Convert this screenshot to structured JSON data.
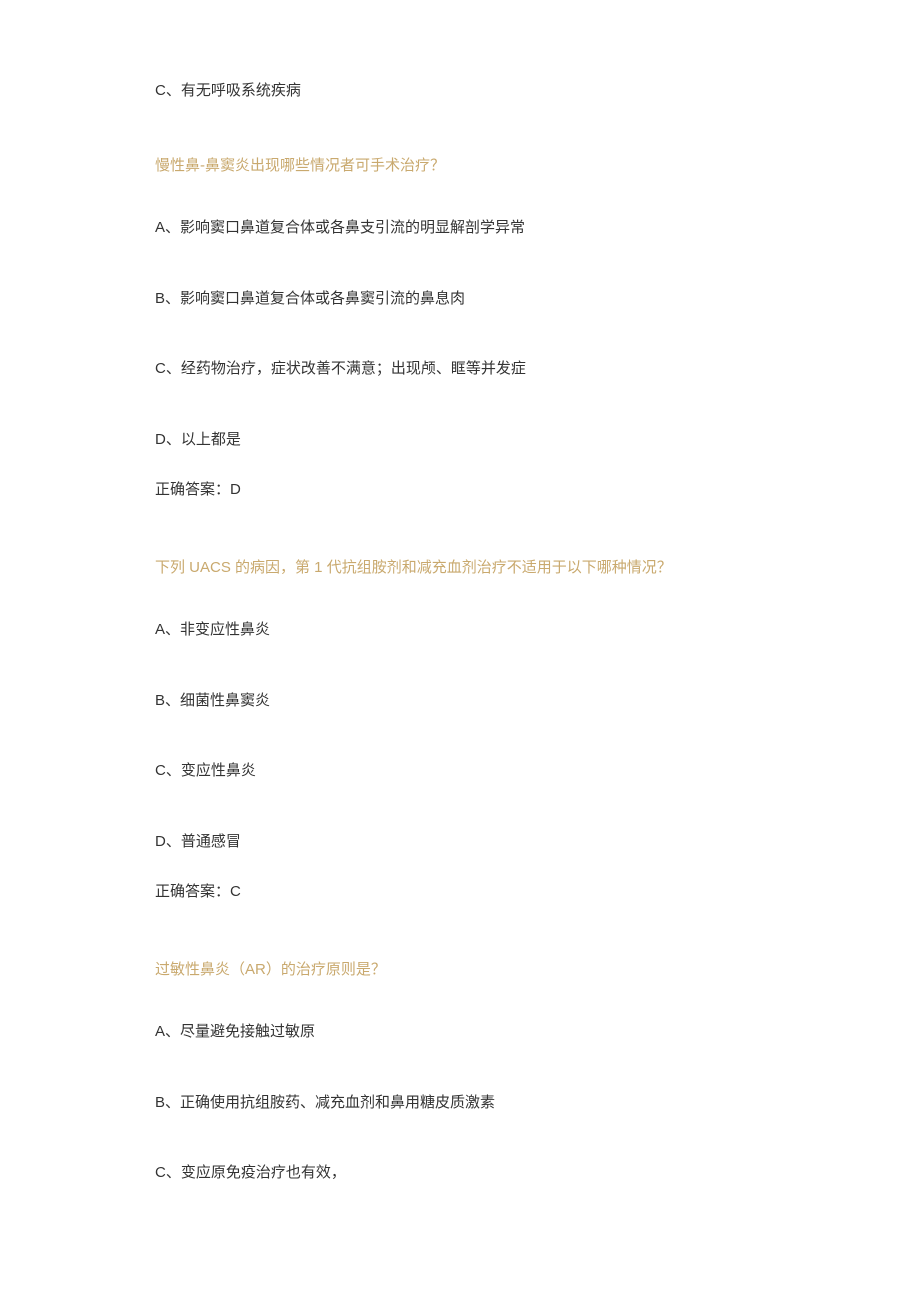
{
  "blocks": [
    {
      "type": "option",
      "text": "C、有无呼吸系统疾病",
      "spacing": "52px"
    },
    {
      "type": "question",
      "text": "慢性鼻-鼻窦炎出现哪些情况者可手术治疗？",
      "spacing": "40px"
    },
    {
      "type": "option",
      "text": "A、影响窦口鼻道复合体或各鼻支引流的明显解剖学异常",
      "spacing": "48px"
    },
    {
      "type": "option",
      "text": "B、影响窦口鼻道复合体或各鼻窦引流的鼻息肉",
      "spacing": "48px"
    },
    {
      "type": "option",
      "text": "C、经药物治疗，症状改善不满意；出现颅、眶等并发症",
      "spacing": "48px"
    },
    {
      "type": "option",
      "text": "D、以上都是",
      "spacing": "28px"
    },
    {
      "type": "answer",
      "text": "正确答案：D",
      "spacing": "55px"
    },
    {
      "type": "question",
      "text": "下列 UACS 的病因，第 1 代抗组胺剂和减充血剂治疗不适用于以下哪种情况？",
      "spacing": "40px"
    },
    {
      "type": "option",
      "text": "A、非变应性鼻炎",
      "spacing": "48px"
    },
    {
      "type": "option",
      "text": "B、细菌性鼻窦炎",
      "spacing": "48px"
    },
    {
      "type": "option",
      "text": "C、变应性鼻炎",
      "spacing": "48px"
    },
    {
      "type": "option",
      "text": "D、普通感冒",
      "spacing": "28px"
    },
    {
      "type": "answer",
      "text": "正确答案：C",
      "spacing": "55px"
    },
    {
      "type": "question",
      "text": "过敏性鼻炎（AR）的治疗原则是？",
      "spacing": "40px"
    },
    {
      "type": "option",
      "text": "A、尽量避免接触过敏原",
      "spacing": "48px"
    },
    {
      "type": "option",
      "text": "B、正确使用抗组胺药、减充血剂和鼻用糖皮质激素",
      "spacing": "48px"
    },
    {
      "type": "option",
      "text": "C、变应原免疫治疗也有效，",
      "spacing": "0px"
    }
  ]
}
